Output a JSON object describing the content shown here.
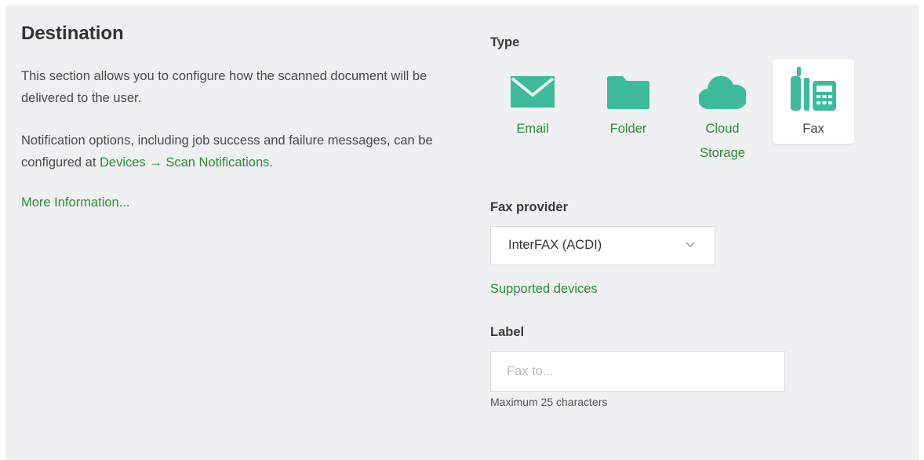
{
  "section": {
    "title": "Destination",
    "description_1": "This section allows you to configure how the scanned document will be delivered to the user.",
    "description_2_prefix": "Notification options, including job success and failure messages, can be configured at ",
    "description_2_link": "Devices → Scan Notifications",
    "description_2_suffix": ".",
    "more_info": "More Information..."
  },
  "type": {
    "label": "Type",
    "options": [
      {
        "label": "Email",
        "icon": "envelope-icon",
        "selected": false
      },
      {
        "label": "Folder",
        "icon": "folder-icon",
        "selected": false
      },
      {
        "label": "Cloud Storage",
        "icon": "cloud-icon",
        "selected": false
      },
      {
        "label": "Fax",
        "icon": "fax-icon",
        "selected": true
      }
    ]
  },
  "fax_provider": {
    "label": "Fax provider",
    "selected": "InterFAX (ACDI)",
    "supported_link": "Supported devices"
  },
  "label_field": {
    "label": "Label",
    "value": "",
    "placeholder": "Fax to...",
    "hint": "Maximum 25 characters"
  },
  "colors": {
    "panel_bg": "#eff0f1",
    "accent_teal": "#3dbb9a",
    "link_green": "#2f8a3d"
  }
}
